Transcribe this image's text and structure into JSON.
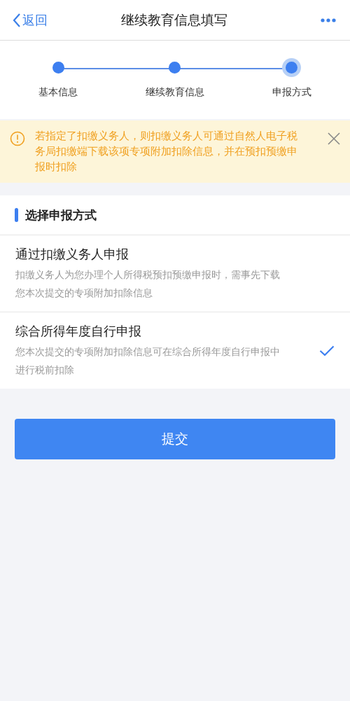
{
  "nav": {
    "back": "返回",
    "title": "继续教育信息填写"
  },
  "steps": [
    {
      "label": "基本信息",
      "selected": false
    },
    {
      "label": "继续教育信息",
      "selected": false
    },
    {
      "label": "申报方式",
      "selected": true
    }
  ],
  "notice": {
    "text": "若指定了扣缴义务人，则扣缴义务人可通过自然人电子税务局扣缴端下载该项专项附加扣除信息，并在预扣预缴申报时扣除"
  },
  "section": {
    "title": "选择申报方式"
  },
  "options": [
    {
      "title": "通过扣缴义务人申报",
      "description": "扣缴义务人为您办理个人所得税预扣预缴申报时，需事先下载您本次提交的专项附加扣除信息",
      "selected": false
    },
    {
      "title": "综合所得年度自行申报",
      "description": "您本次提交的专项附加扣除信息可在综合所得年度自行申报中进行税前扣除",
      "selected": true
    }
  ],
  "submit": "提交"
}
